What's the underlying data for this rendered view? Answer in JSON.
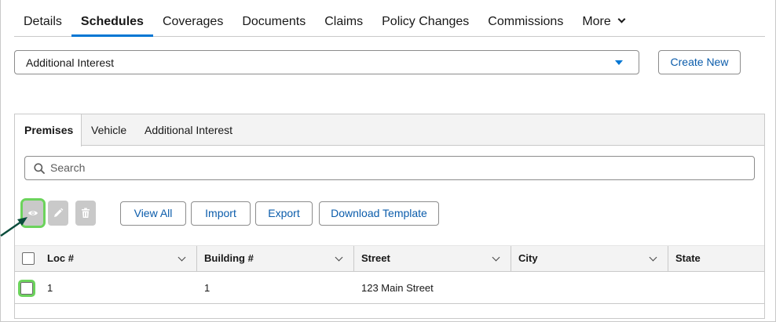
{
  "top_tabs": [
    {
      "label": "Details"
    },
    {
      "label": "Schedules",
      "active": true
    },
    {
      "label": "Coverages"
    },
    {
      "label": "Documents"
    },
    {
      "label": "Claims"
    },
    {
      "label": "Policy Changes"
    },
    {
      "label": "Commissions"
    },
    {
      "label": "More"
    }
  ],
  "schedule_select": {
    "value": "Additional Interest"
  },
  "create_new_label": "Create New",
  "inner_tabs": [
    {
      "label": "Premises",
      "active": true
    },
    {
      "label": "Vehicle"
    },
    {
      "label": "Additional Interest"
    }
  ],
  "search": {
    "placeholder": "Search"
  },
  "toolbar": {
    "view_all_label": "View All",
    "import_label": "Import",
    "export_label": "Export",
    "download_template_label": "Download Template"
  },
  "table": {
    "columns": [
      "Loc #",
      "Building #",
      "Street",
      "City",
      "State"
    ],
    "rows": [
      {
        "loc": "1",
        "building": "1",
        "street": "123 Main Street",
        "city": "",
        "state": ""
      }
    ]
  },
  "colors": {
    "accent": "#0176d3",
    "highlight": "#6cd35c",
    "arrow": "#0b4d3c"
  }
}
